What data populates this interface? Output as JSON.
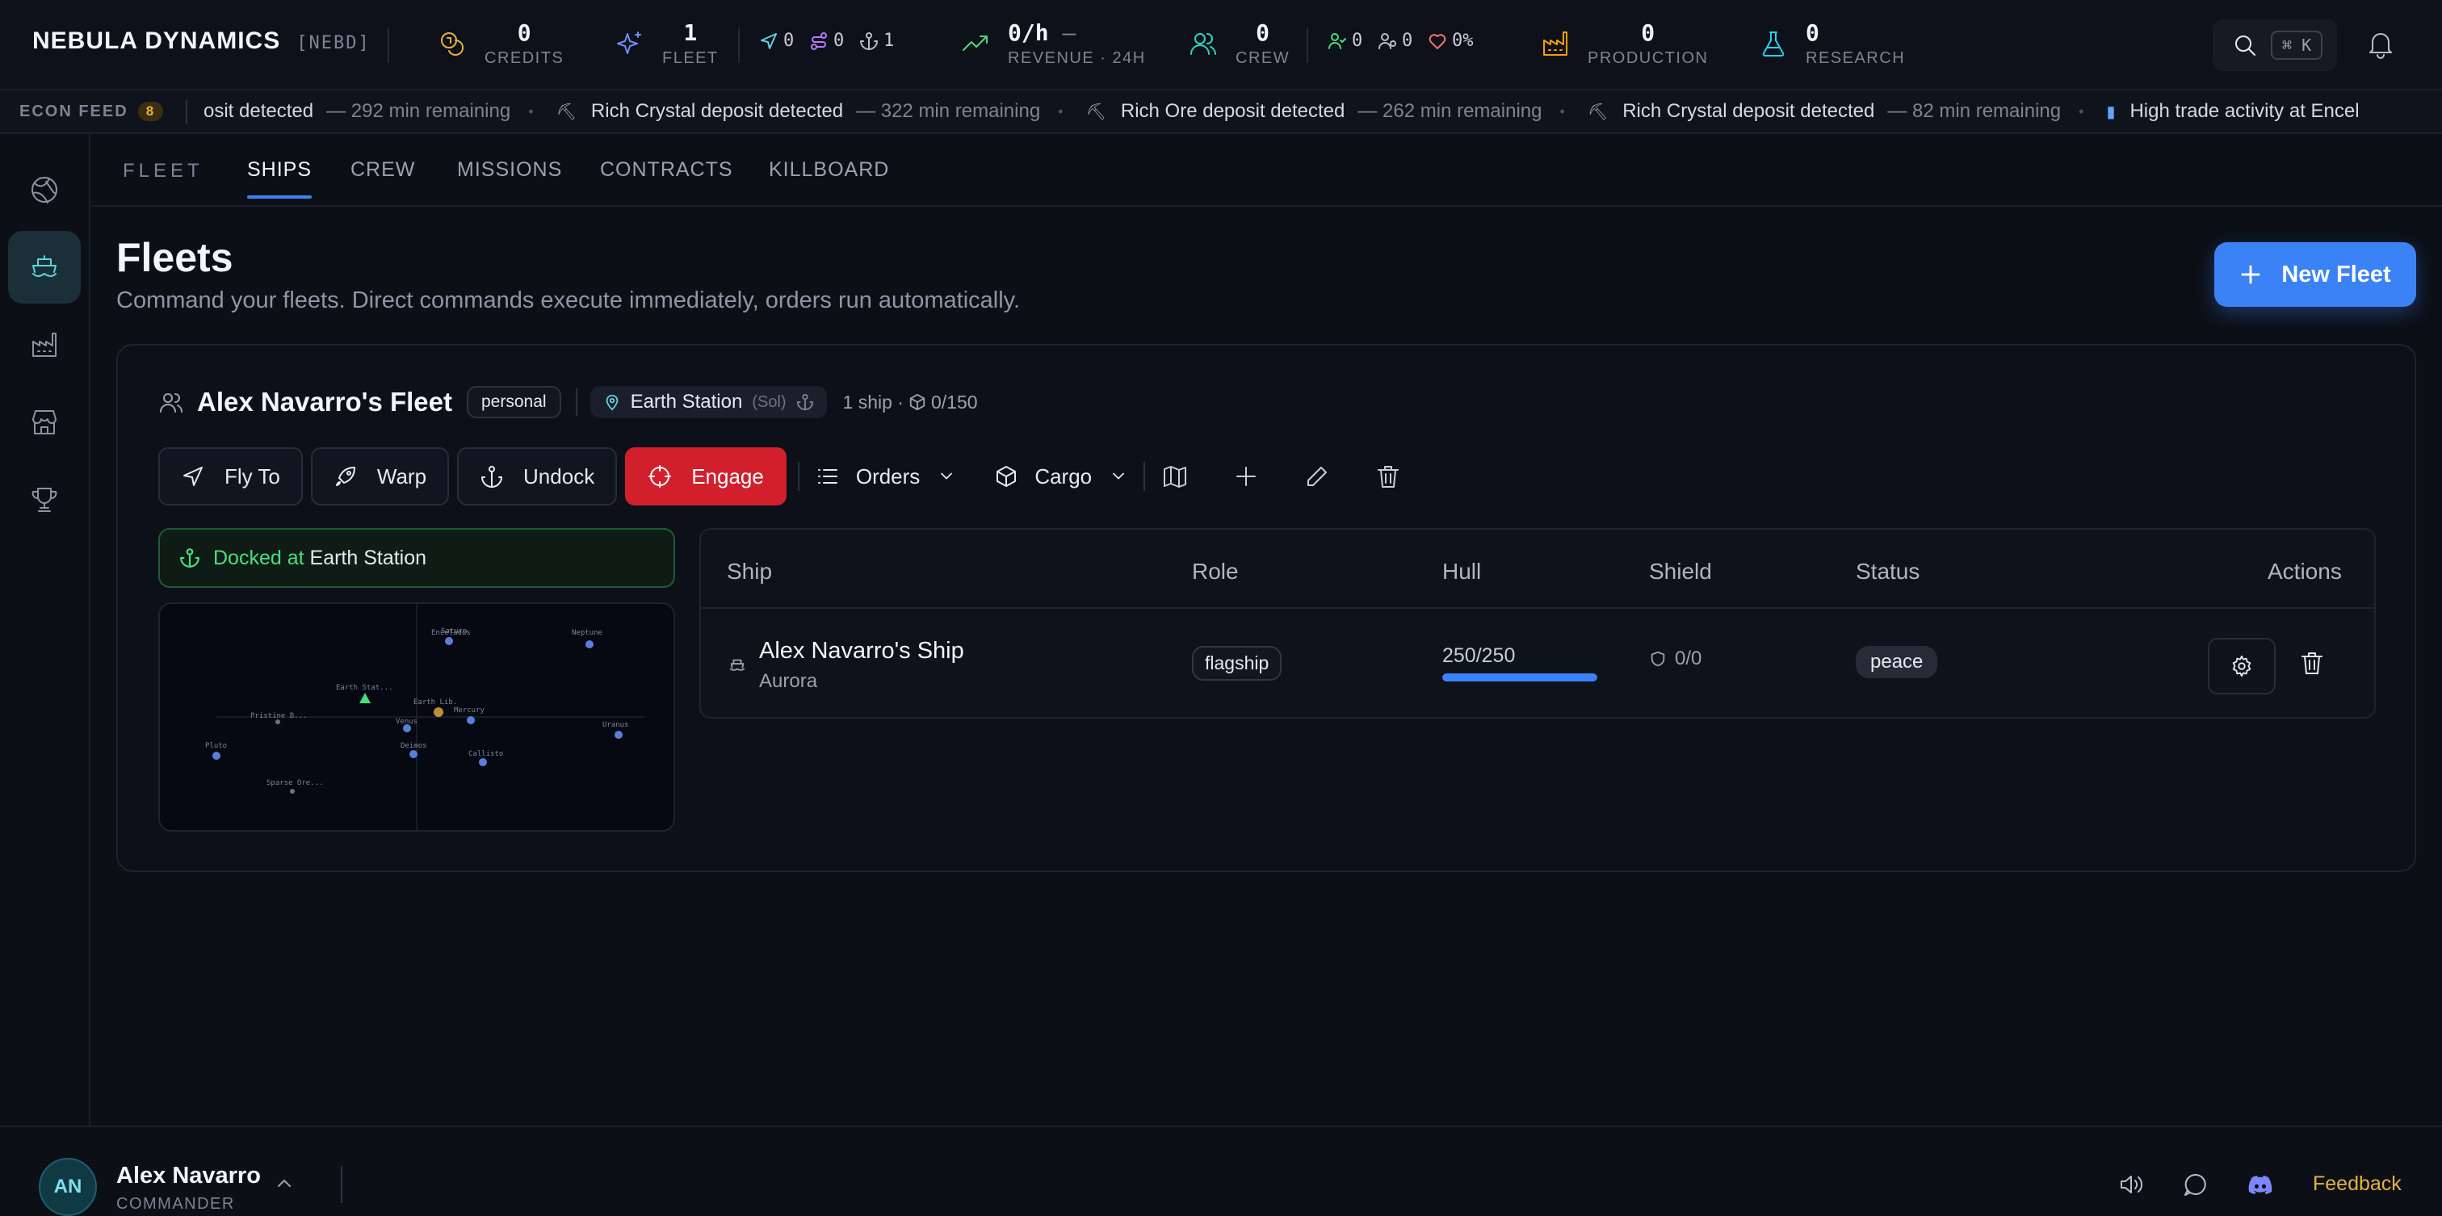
{
  "brand": {
    "name": "NEBULA DYNAMICS",
    "ticker": "[NEBD]"
  },
  "stats": {
    "credits": {
      "value": "0",
      "label": "CREDITS"
    },
    "fleet": {
      "value": "1",
      "label": "FLEET",
      "moving": "0",
      "warping": "0",
      "docked": "1"
    },
    "revenue": {
      "value": "0/h",
      "trend": "—",
      "label": "REVENUE · 24H"
    },
    "crew": {
      "value": "0",
      "label": "CREW",
      "assigned": "0",
      "idle": "0",
      "morale": "0%"
    },
    "production": {
      "value": "0",
      "label": "PRODUCTION"
    },
    "research": {
      "value": "0",
      "label": "RESEARCH"
    }
  },
  "search": {
    "shortcut": "⌘ K"
  },
  "ticker": {
    "label": "ECON FEED",
    "count": "8",
    "items": [
      {
        "message": "osit detected",
        "remaining": "— 292 min remaining",
        "icon": "pickaxe-icon"
      },
      {
        "message": "Rich Crystal deposit detected",
        "remaining": "— 322 min remaining",
        "icon": "pickaxe-icon"
      },
      {
        "message": "Rich Ore deposit detected",
        "remaining": "— 262 min remaining",
        "icon": "pickaxe-icon"
      },
      {
        "message": "Rich Crystal deposit detected",
        "remaining": "— 82 min remaining",
        "icon": "pickaxe-icon"
      },
      {
        "message": "High trade activity at Encel",
        "remaining": "",
        "icon": "chart-icon"
      }
    ]
  },
  "subnav": {
    "title": "FLEET",
    "tabs": [
      "SHIPS",
      "CREW",
      "MISSIONS",
      "CONTRACTS",
      "KILLBOARD"
    ]
  },
  "page": {
    "title": "Fleets",
    "subtitle": "Command your fleets. Direct commands execute immediately, orders run automatically.",
    "new_fleet_label": "New Fleet"
  },
  "fleet": {
    "name": "Alex Navarro's Fleet",
    "type": "personal",
    "location": "Earth Station",
    "system": "(Sol)",
    "ship_count": "1 ship ·",
    "cargo": "0/150",
    "actions": {
      "fly_to": "Fly To",
      "warp": "Warp",
      "undock": "Undock",
      "engage": "Engage",
      "orders": "Orders",
      "cargo": "Cargo"
    },
    "docked_label": "Docked at",
    "docked_location": "Earth Station"
  },
  "minimap": {
    "labels": [
      "Saturn",
      "Enceladus",
      "Neptune",
      "Earth Stat...",
      "Pristine B...",
      "Mercury",
      "Venus",
      "Uranus",
      "Pluto",
      "Deimos",
      "Callisto",
      "Sparse Ore..."
    ]
  },
  "table": {
    "headers": [
      "Ship",
      "Role",
      "Hull",
      "Shield",
      "Status",
      "Actions"
    ],
    "rows": [
      {
        "name": "Alex Navarro's Ship",
        "class": "Aurora",
        "role": "flagship",
        "hull": "250/250",
        "hull_pct": 100,
        "shield": "0/0",
        "status": "peace"
      }
    ]
  },
  "user": {
    "initials": "AN",
    "name": "Alex Navarro",
    "role": "COMMANDER"
  },
  "footer": {
    "feedback": "Feedback"
  },
  "colors": {
    "accent": "#3b82f6",
    "danger": "#d1202c",
    "success": "#4ade80",
    "cyan": "#5fd3e0",
    "gold": "#e3b341"
  }
}
